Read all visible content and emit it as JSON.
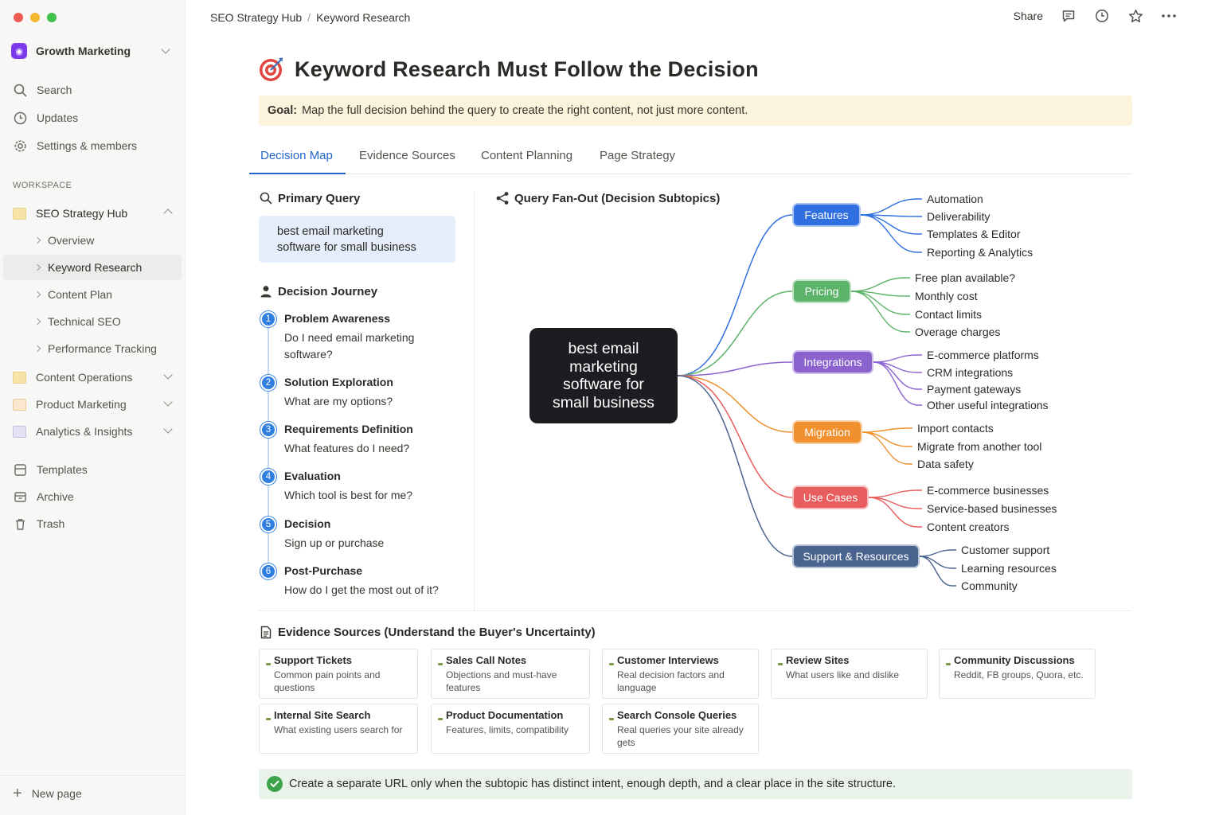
{
  "sidebar": {
    "workspace": "Growth Marketing",
    "nav": [
      "Search",
      "Updates",
      "Settings & members"
    ],
    "section_label": "WORKSPACE",
    "pages": {
      "seo_hub": "SEO Strategy Hub",
      "sub_items": [
        "Overview",
        "Keyword Research",
        "Content Plan",
        "Technical SEO",
        "Performance Tracking"
      ],
      "content_ops": "Content Operations",
      "product_marketing": "Product Marketing",
      "analytics": "Analytics & Insights"
    },
    "utility": [
      "Templates",
      "Archive",
      "Trash"
    ],
    "new_page": "New page"
  },
  "breadcrumb": [
    "SEO Strategy Hub",
    "Keyword Research"
  ],
  "topbar": {
    "share": "Share"
  },
  "page": {
    "title": "Keyword Research Must Follow the Decision",
    "goal_label": "Goal:",
    "goal_text": "Map the full decision behind the query to create the right content, not just more content."
  },
  "tabs": [
    "Decision Map",
    "Evidence Sources",
    "Content Planning",
    "Page Strategy"
  ],
  "primary_query": {
    "heading": "Primary Query",
    "line1": "best email marketing",
    "line2": "software for small business"
  },
  "journey": {
    "heading": "Decision Journey",
    "steps": [
      {
        "num": "1",
        "title": "Problem Awareness",
        "desc": "Do I need email marketing software?"
      },
      {
        "num": "2",
        "title": "Solution Exploration",
        "desc": "What are my options?"
      },
      {
        "num": "3",
        "title": "Requirements Definition",
        "desc": "What features do I need?"
      },
      {
        "num": "4",
        "title": "Evaluation",
        "desc": "Which tool is best for me?"
      },
      {
        "num": "5",
        "title": "Decision",
        "desc": "Sign up or purchase"
      },
      {
        "num": "6",
        "title": "Post-Purchase",
        "desc": "How do I get the most out of it?"
      }
    ]
  },
  "fanout": {
    "heading": "Query Fan-Out (Decision Subtopics)",
    "root": [
      "best email",
      "marketing",
      "software for",
      "small business"
    ],
    "branches": [
      {
        "label": "Features",
        "color": "#2f6fe0",
        "leaves": [
          "Automation",
          "Deliverability",
          "Templates & Editor",
          "Reporting & Analytics"
        ]
      },
      {
        "label": "Pricing",
        "color": "#5cb36a",
        "leaves": [
          "Free plan available?",
          "Monthly cost",
          "Contact limits",
          "Overage charges"
        ]
      },
      {
        "label": "Integrations",
        "color": "#8a63cf",
        "leaves": [
          "E-commerce platforms",
          "CRM integrations",
          "Payment gateways",
          "Other useful integrations"
        ]
      },
      {
        "label": "Migration",
        "color": "#f0902e",
        "leaves": [
          "Import contacts",
          "Migrate from another tool",
          "Data safety"
        ]
      },
      {
        "label": "Use Cases",
        "color": "#e85d5d",
        "leaves": [
          "E-commerce businesses",
          "Service-based businesses",
          "Content creators"
        ]
      },
      {
        "label": "Support & Resources",
        "color": "#4a6490",
        "leaves": [
          "Customer support",
          "Learning resources",
          "Community"
        ]
      }
    ]
  },
  "evidence": {
    "heading": "Evidence Sources (Understand the Buyer's Uncertainty)",
    "cards": [
      {
        "title": "Support Tickets",
        "desc": "Common pain points and questions"
      },
      {
        "title": "Sales Call Notes",
        "desc": "Objections and must-have features"
      },
      {
        "title": "Customer Interviews",
        "desc": "Real decision factors and language"
      },
      {
        "title": "Review Sites",
        "desc": "What users like and dislike"
      },
      {
        "title": "Community Discussions",
        "desc": "Reddit, FB groups, Quora, etc."
      },
      {
        "title": "Internal Site Search",
        "desc": "What existing users search for"
      },
      {
        "title": "Product Documentation",
        "desc": "Features, limits, compatibility"
      },
      {
        "title": "Search Console Queries",
        "desc": "Real queries your site already gets"
      }
    ]
  },
  "callout": "Create a separate URL only when the subtopic has distinct intent, enough depth, and a clear place in the site structure."
}
